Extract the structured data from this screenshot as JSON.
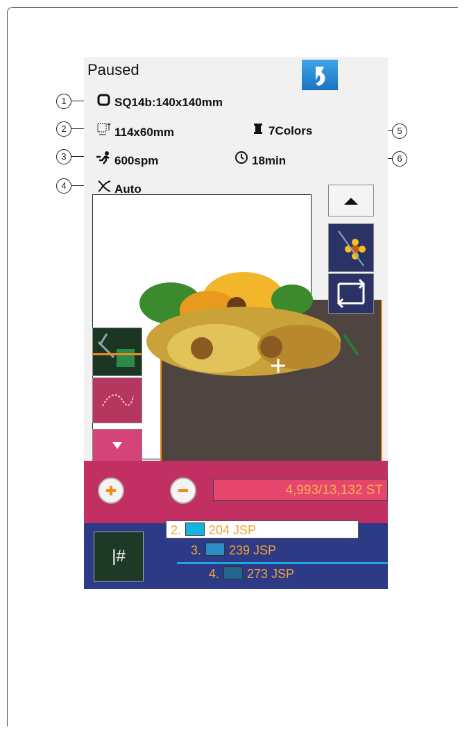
{
  "status": "Paused",
  "hoop": {
    "icon": "hoop-icon",
    "text": "SQ14b:140x140mm"
  },
  "size": {
    "icon": "size-icon",
    "text": "114x60mm"
  },
  "colors": {
    "icon": "spool-icon",
    "text": "7Colors"
  },
  "speed": {
    "icon": "runner-icon",
    "text": "600spm"
  },
  "time": {
    "icon": "clock-icon",
    "text": "18min"
  },
  "trim": {
    "icon": "scissors-icon",
    "text": "Auto"
  },
  "callouts": [
    "1",
    "2",
    "3",
    "4",
    "5",
    "6"
  ],
  "stitch_count": "4,993/13,132 ST",
  "threads": [
    {
      "num": "2.",
      "code": "204 JSP",
      "color": "#14b3e0"
    },
    {
      "num": "3.",
      "code": "239 JSP",
      "color": "#2a8ec4"
    },
    {
      "num": "4.",
      "code": "273 JSP",
      "color": "#23658f"
    }
  ],
  "thread_button": "|#",
  "accent_colors": {
    "pink": "#c22f63",
    "blue": "#2d3a86",
    "orange": "#f08a1a"
  }
}
